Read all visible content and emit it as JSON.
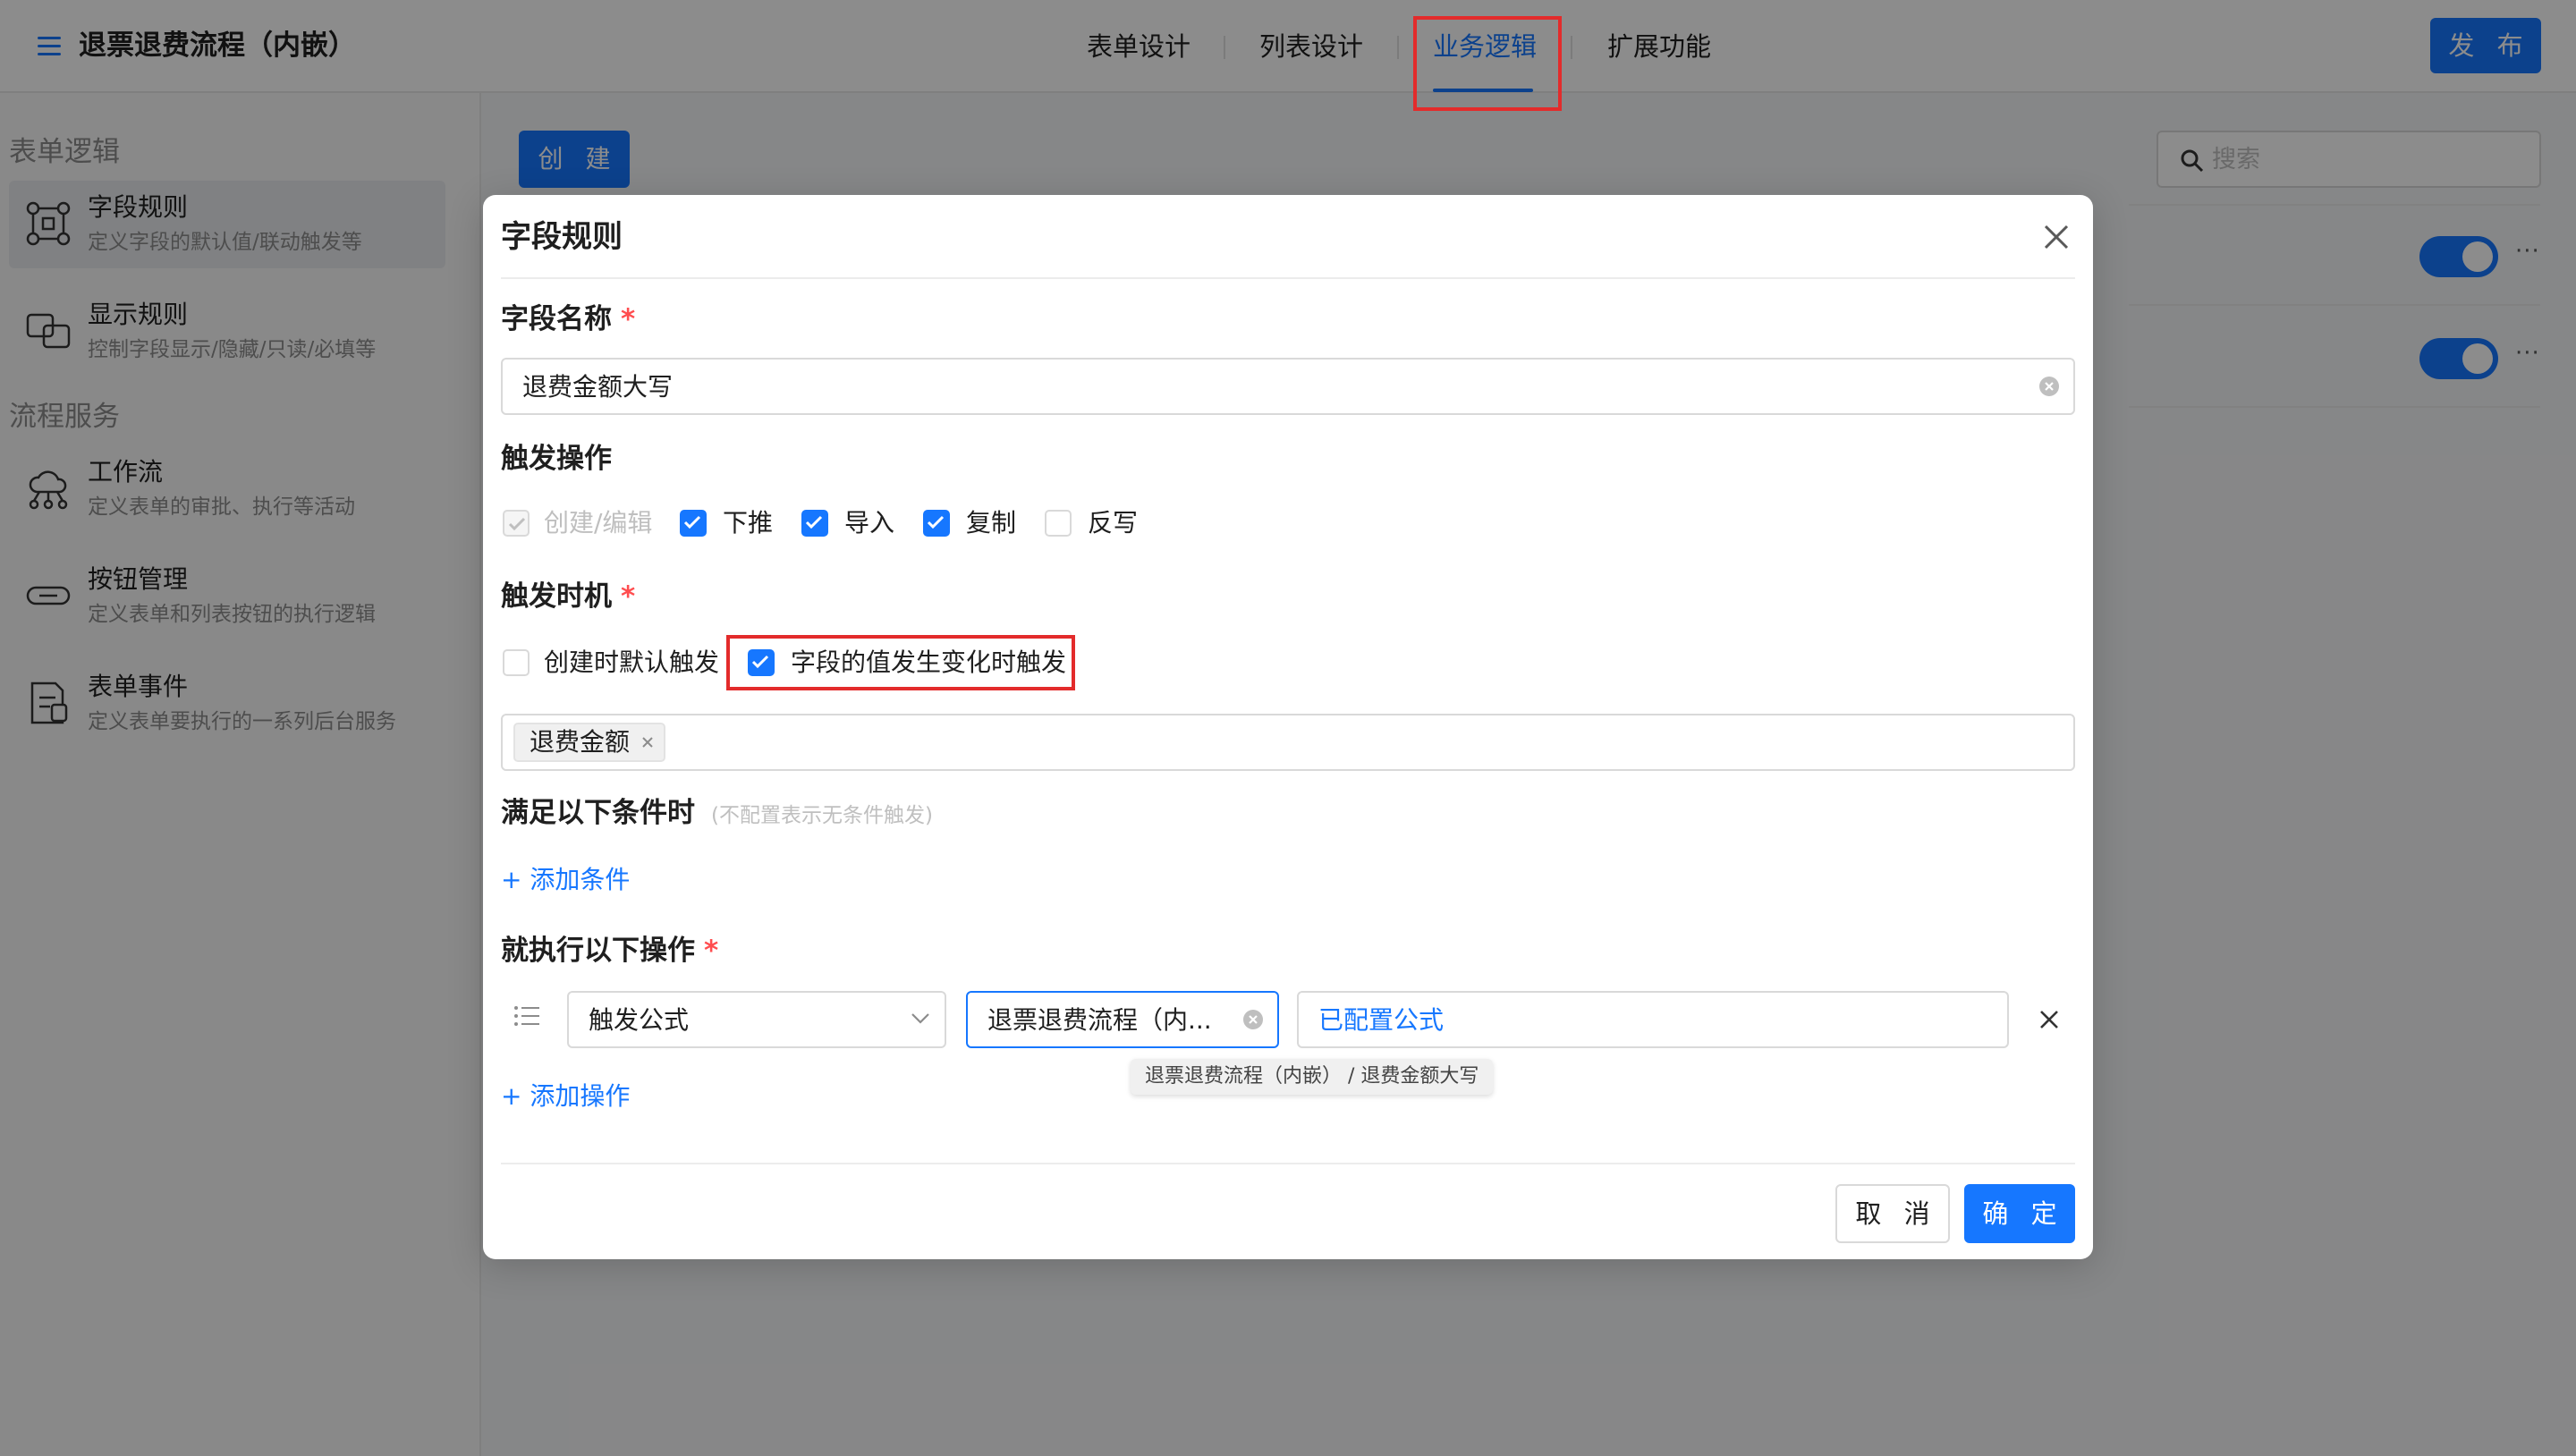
{
  "header": {
    "title": "退票退费流程（内嵌）",
    "tabs": [
      {
        "label": "表单设计"
      },
      {
        "label": "列表设计"
      },
      {
        "label": "业务逻辑",
        "active": true
      },
      {
        "label": "扩展功能"
      }
    ],
    "publish_label": "发 布"
  },
  "sidebar": {
    "sections": [
      {
        "title": "表单逻辑",
        "items": [
          {
            "label": "字段规则",
            "desc": "定义字段的默认值/联动触发等",
            "icon": "field-rule-icon",
            "active": true
          },
          {
            "label": "显示规则",
            "desc": "控制字段显示/隐藏/只读/必填等",
            "icon": "display-rule-icon"
          }
        ]
      },
      {
        "title": "流程服务",
        "items": [
          {
            "label": "工作流",
            "desc": "定义表单的审批、执行等活动",
            "icon": "workflow-icon"
          },
          {
            "label": "按钮管理",
            "desc": "定义表单和列表按钮的执行逻辑",
            "icon": "button-icon"
          },
          {
            "label": "表单事件",
            "desc": "定义表单要执行的一系列后台服务",
            "icon": "form-event-icon"
          }
        ]
      }
    ]
  },
  "main": {
    "create_label": "创 建",
    "search_placeholder": "搜索",
    "rows": [
      {
        "enabled": true,
        "more": "···"
      },
      {
        "enabled": true,
        "more": "···"
      }
    ]
  },
  "modal": {
    "title": "字段规则",
    "field_name": {
      "label": "字段名称",
      "required": "*",
      "value": "退费金额大写"
    },
    "trigger_ops": {
      "label": "触发操作",
      "options": [
        {
          "label": "创建/编辑",
          "checked": true,
          "disabled": true
        },
        {
          "label": "下推",
          "checked": true
        },
        {
          "label": "导入",
          "checked": true
        },
        {
          "label": "复制",
          "checked": true
        },
        {
          "label": "反写",
          "checked": false
        }
      ]
    },
    "trigger_timing": {
      "label": "触发时机",
      "required": "*",
      "options": [
        {
          "label": "创建时默认触发",
          "checked": false
        },
        {
          "label": "字段的值发生变化时触发",
          "checked": true
        }
      ],
      "fields": [
        "退费金额"
      ]
    },
    "conditions": {
      "label": "满足以下条件时",
      "hint": "(不配置表示无条件触发)",
      "add_label": "+ 添加条件"
    },
    "actions": {
      "label": "就执行以下操作",
      "required": "*",
      "rows": [
        {
          "type": "触发公式",
          "target": "退票退费流程（内...",
          "target_tooltip": "退票退费流程（内嵌） / 退费金额大写",
          "config": "已配置公式"
        }
      ],
      "add_label": "+ 添加操作"
    },
    "cancel_label": "取 消",
    "ok_label": "确 定"
  },
  "colors": {
    "primary": "#1677ff",
    "highlight": "#e32b2b",
    "required": "#ff4d4f"
  }
}
